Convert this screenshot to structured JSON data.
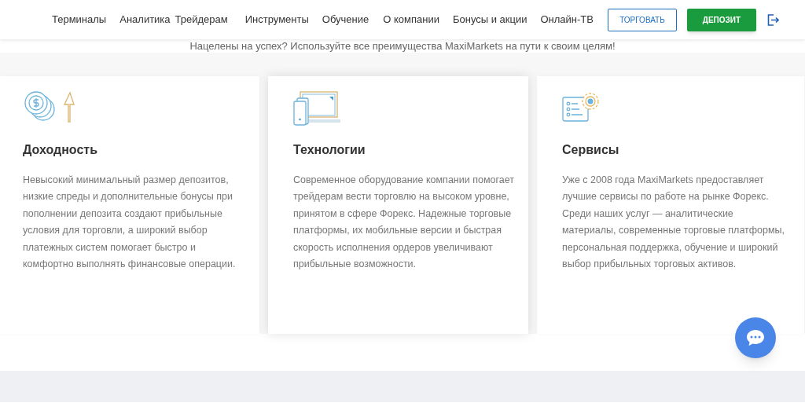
{
  "nav": {
    "items": [
      "Терминалы",
      "Аналитика",
      "Трейдерам",
      "Инструменты",
      "Обучение",
      "О компании",
      "Бонусы и акции",
      "Онлайн-ТВ"
    ],
    "buttons": [
      {
        "label": "ТОРГОВАТЬ",
        "kind": "outline"
      },
      {
        "label": "ДЕПОЗИТ",
        "kind": "filled"
      }
    ]
  },
  "subtitle": "Нацелены на успех? Используйте все преимущества MaxiMarkets на пути к своим целям!",
  "features": [
    {
      "kind": "coins",
      "title": "Доходность",
      "text": "Невысокий минимальный размер депозитов, низкие спреды и дополнительные бонусы при пополнении депозита создают прибыльные условия для торговли, а широкий выбор платежных систем помогает быстро и комфортно выполнять финансовые операции."
    },
    {
      "kind": "devices",
      "title": "Технологии",
      "text": "Современное оборудование компании помогает трейдерам вести торговлю на высоком уровне, принятом в сфере Форекс. Надежные торговые платформы, их мобильные версии и быстрая скорость исполнения ордеров увеличивают прибыльные возможности."
    },
    {
      "kind": "services",
      "title": "Сервисы",
      "text": "Уже с 2008 года MaxiMarkets предоставляет лучшие сервисы по работе на рынке Форекс. Среди наших услуг — аналитические материалы, современные торговые платформы, персональная поддержка, обучение и широкий выбор прибыльных торговых активов."
    }
  ]
}
